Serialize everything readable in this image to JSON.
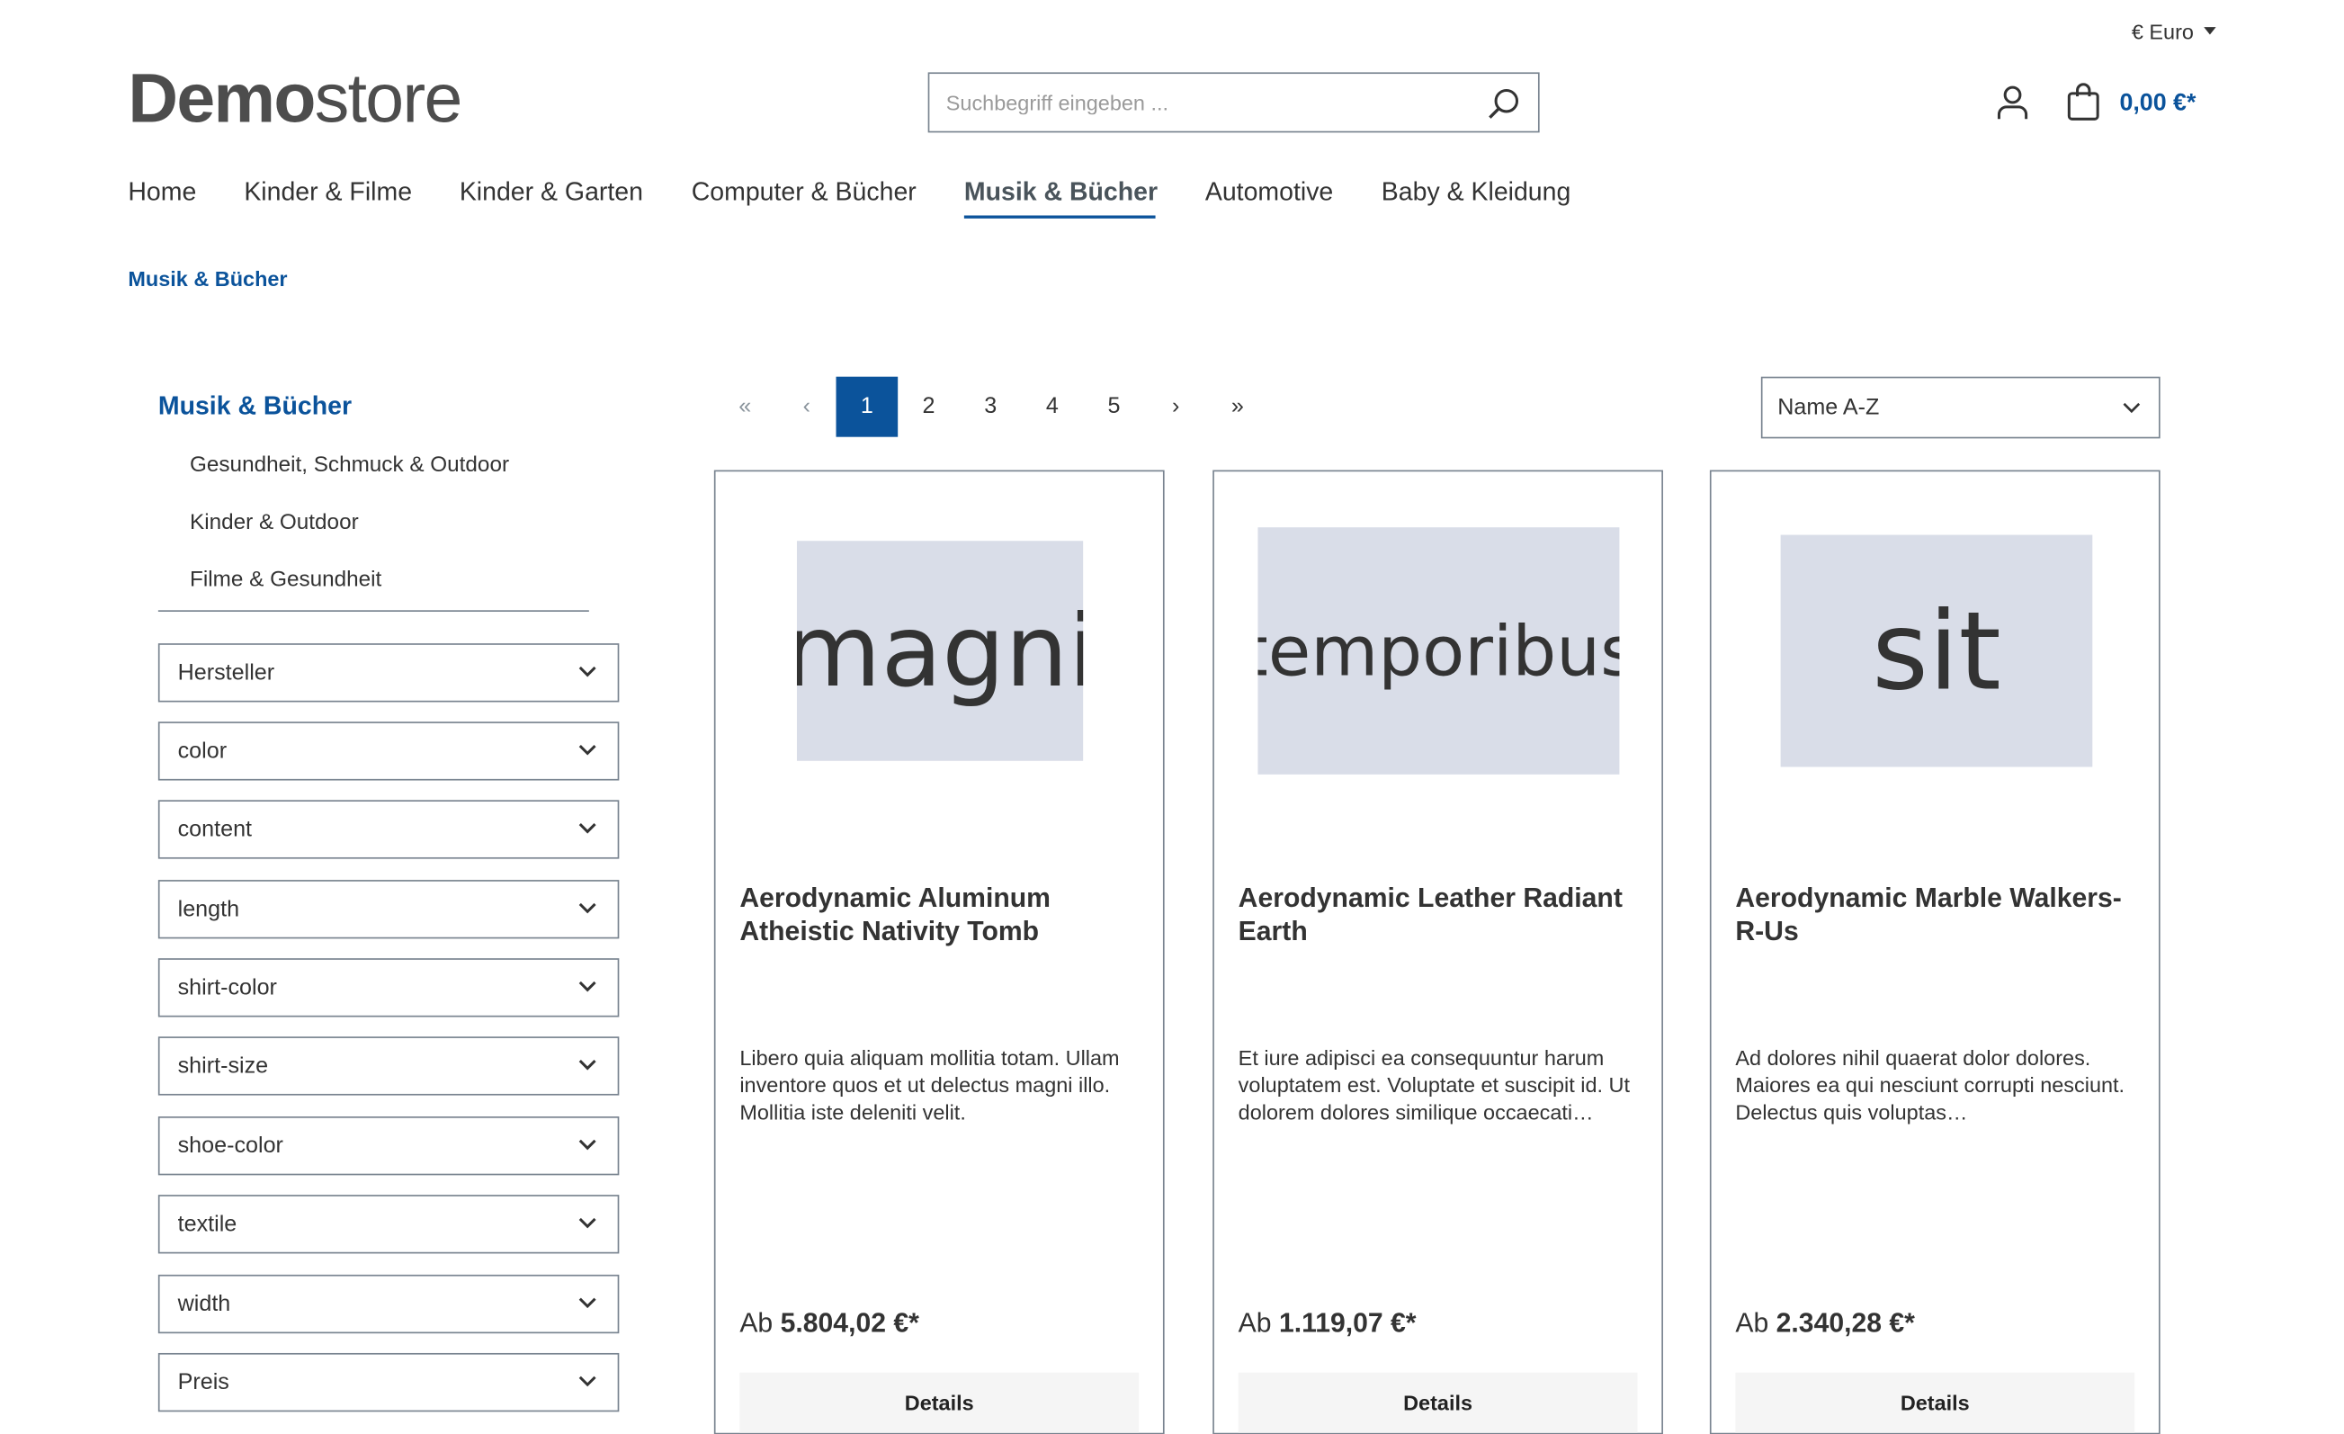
{
  "header": {
    "logo_bold": "Demo",
    "logo_light": "store",
    "currency": "€ Euro",
    "search_placeholder": "Suchbegriff eingeben ...",
    "cart_total": "0,00 €*"
  },
  "nav": [
    {
      "label": "Home"
    },
    {
      "label": "Kinder & Filme"
    },
    {
      "label": "Kinder & Garten"
    },
    {
      "label": "Computer & Bücher"
    },
    {
      "label": "Musik & Bücher",
      "active": true
    },
    {
      "label": "Automotive"
    },
    {
      "label": "Baby & Kleidung"
    }
  ],
  "breadcrumb": "Musik & Bücher",
  "sidebar": {
    "title": "Musik & Bücher",
    "items": [
      "Gesundheit, Schmuck & Outdoor",
      "Kinder & Outdoor",
      "Filme & Gesundheit"
    ],
    "filters": [
      "Hersteller",
      "color",
      "content",
      "length",
      "shirt-color",
      "shirt-size",
      "shoe-color",
      "textile",
      "width",
      "Preis"
    ]
  },
  "pagination": {
    "first": "«",
    "prev": "‹",
    "pages": [
      "1",
      "2",
      "3",
      "4",
      "5"
    ],
    "current": "1",
    "next": "›",
    "last": "»"
  },
  "sort": {
    "selected": "Name A-Z"
  },
  "products": [
    {
      "image_text": "magni",
      "title": "Aerodynamic Aluminum Atheistic Nativity Tomb",
      "description": "Libero quia aliquam mollitia totam. Ullam inventore quos et ut delectus magni illo. Mollitia iste deleniti velit.",
      "price_prefix": "Ab",
      "price": "5.804,02 €*",
      "button": "Details"
    },
    {
      "image_text": "temporibus",
      "title": "Aerodynamic Leather Radiant Earth",
      "description": "Et iure adipisci ea consequuntur harum voluptatem est. Voluptate et suscipit id. Ut dolorem dolores similique occaecati…",
      "price_prefix": "Ab",
      "price": "1.119,07 €*",
      "button": "Details"
    },
    {
      "image_text": "sit",
      "title": "Aerodynamic Marble Walkers-R-Us",
      "description": "Ad dolores nihil quaerat dolor dolores. Maiores ea qui nesciunt corrupti nesciunt. Delectus quis voluptas…",
      "price_prefix": "Ab",
      "price": "2.340,28 €*",
      "button": "Details"
    }
  ],
  "colors": {
    "primary": "#0b539b",
    "placeholder_bg": "#d9dde8",
    "border": "#798490"
  }
}
